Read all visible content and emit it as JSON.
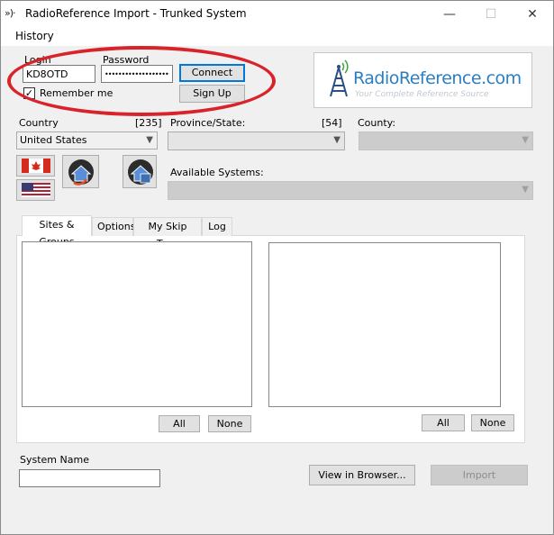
{
  "window": {
    "title": "RadioReference Import - Trunked System",
    "app_icon": "antenna-icon",
    "controls": {
      "minimize": "—",
      "maximize": "☐",
      "close": "✕"
    }
  },
  "menu": {
    "history": "History"
  },
  "login": {
    "login_label": "Login",
    "login_value": "KD8OTD",
    "password_label": "Password",
    "password_value": "••••••••••••••••••••",
    "connect": "Connect",
    "signup": "Sign Up",
    "remember_label": "Remember me",
    "remember_checked": true
  },
  "logo": {
    "name": "RadioReference.com",
    "tagline": "Your Complete Reference Source"
  },
  "location": {
    "country_label": "Country",
    "country_count": "[235]",
    "country_value": "United States",
    "province_label": "Province/State:",
    "province_count": "[54]",
    "province_value": "",
    "county_label": "County:",
    "county_value": "",
    "systems_label": "Available Systems:",
    "systems_value": ""
  },
  "tabs": [
    {
      "label": "Sites & Groups",
      "active": true
    },
    {
      "label": "Options"
    },
    {
      "label": "My Skip Tags"
    },
    {
      "label": "Log"
    }
  ],
  "panel": {
    "left_all": "All",
    "left_none": "None",
    "right_all": "All",
    "right_none": "None"
  },
  "footer": {
    "system_name_label": "System Name",
    "system_name_value": "",
    "view_browser": "View in Browser...",
    "import": "Import"
  },
  "colors": {
    "highlight_oval": "#d8232a",
    "logo_blue": "#2b7ec1"
  }
}
